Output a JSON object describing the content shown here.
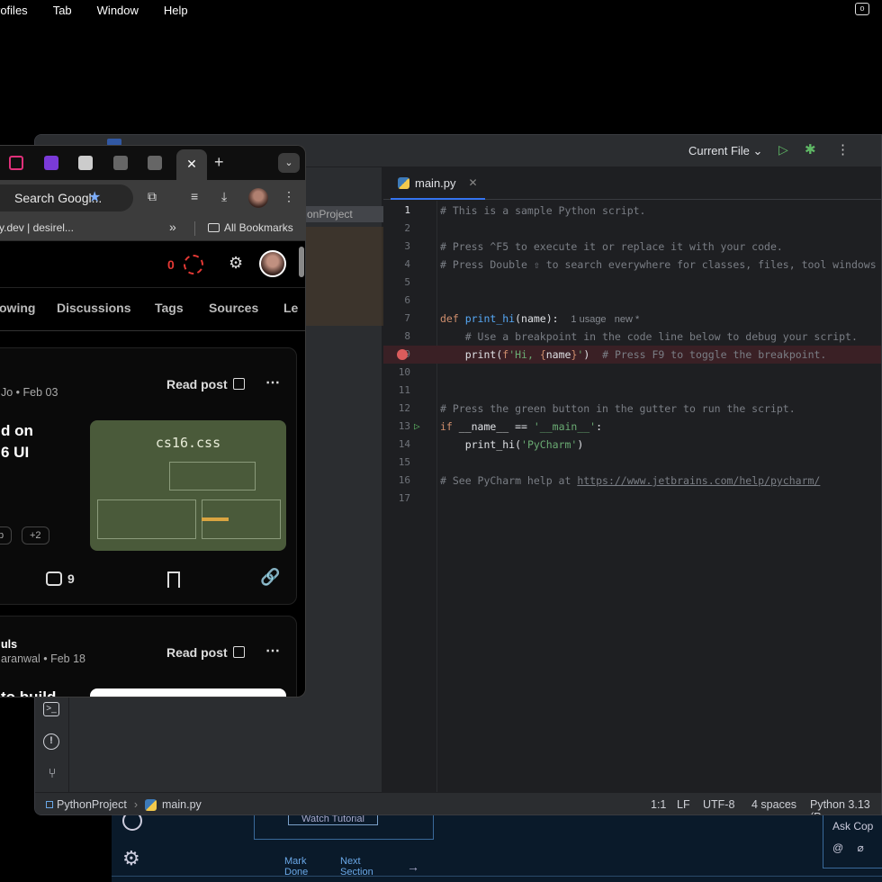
{
  "menubar": {
    "items": [
      "rofiles",
      "Tab",
      "Window",
      "Help"
    ]
  },
  "bg_app": {
    "watch_label": "Watch Tutorial",
    "mark_done": "Mark Done",
    "next_section": "Next Section",
    "ask_label": "Ask Cop",
    "ask_icons": "@ ⌀"
  },
  "ide": {
    "run_config": "Current File",
    "project_selected": "onProject",
    "tab_label": "main.py",
    "code_lines": [
      {
        "n": "1",
        "cur": true,
        "html": "<span class='c-com'># This is a sample Python script.</span>"
      },
      {
        "n": "2",
        "html": ""
      },
      {
        "n": "3",
        "html": "<span class='c-com'># Press ^F5 to execute it or replace it with your code.</span>"
      },
      {
        "n": "4",
        "html": "<span class='c-com'># Press Double ⇧ to search everywhere for classes, files, tool windows</span>"
      },
      {
        "n": "5",
        "html": ""
      },
      {
        "n": "6",
        "html": ""
      },
      {
        "n": "7",
        "html": "<span class='c-kw'>def </span><span class='c-fn'>print_hi</span><span class='c-var'>(name):  </span><span class='c-hint'>1 usage   new *</span>"
      },
      {
        "n": "8",
        "html": "    <span class='c-com'># Use a breakpoint in the code line below to debug your script.</span>"
      },
      {
        "n": "9",
        "bp": true,
        "html": "    <span class='c-var'>print(</span><span class='c-fx'>f</span><span class='c-str'>'Hi, </span><span class='c-fx'>{</span><span class='c-var'>name</span><span class='c-fx'>}</span><span class='c-str'>'</span><span class='c-var'>)  </span><span class='c-com'># Press F9 to toggle the breakpoint.</span>"
      },
      {
        "n": "10",
        "html": ""
      },
      {
        "n": "11",
        "html": ""
      },
      {
        "n": "12",
        "html": "<span class='c-com'># Press the green button in the gutter to run the script.</span>"
      },
      {
        "n": "13",
        "run": true,
        "html": "<span class='c-kw'>if </span><span class='c-var'>__name__ == </span><span class='c-str'>'__main__'</span><span class='c-var'>:</span>"
      },
      {
        "n": "14",
        "html": "    <span class='c-var'>print_hi(</span><span class='c-str'>'PyCharm'</span><span class='c-var'>)</span>"
      },
      {
        "n": "15",
        "html": ""
      },
      {
        "n": "16",
        "html": "<span class='c-com'># See PyCharm help at </span><span class='c-link'>https://www.jetbrains.com/help/pycharm/</span>"
      },
      {
        "n": "17",
        "html": ""
      }
    ],
    "status": {
      "project": "PythonProject",
      "file": "main.py",
      "position": "1:1",
      "line_sep": "LF",
      "encoding": "UTF-8",
      "indent": "4 spaces",
      "interpreter": "Python 3.13 (P"
    }
  },
  "chrome": {
    "omnibox": "Search Googl...",
    "bookmark1": "y.dev |  desirel...",
    "all_bookmarks": "All Bookmarks",
    "tab_colors": [
      "#e0307a",
      "#7a3ad8",
      "#ccc",
      "#777",
      "#777"
    ]
  },
  "devto": {
    "notif_count": "0",
    "nav": [
      "owing",
      "Discussions",
      "Tags",
      "Sources",
      "Le"
    ],
    "card1": {
      "meta": "Jo • Feb 03",
      "read_label": "Read post",
      "title_line1": "d on",
      "title_line2": "6 UI",
      "thumb_title": "cs16.css",
      "tag1": "b",
      "tag2": "+2",
      "comments": "9"
    },
    "card2": {
      "author": "uls",
      "meta": "aranwal • Feb 18",
      "read_label": "Read post",
      "title": "to build"
    }
  }
}
